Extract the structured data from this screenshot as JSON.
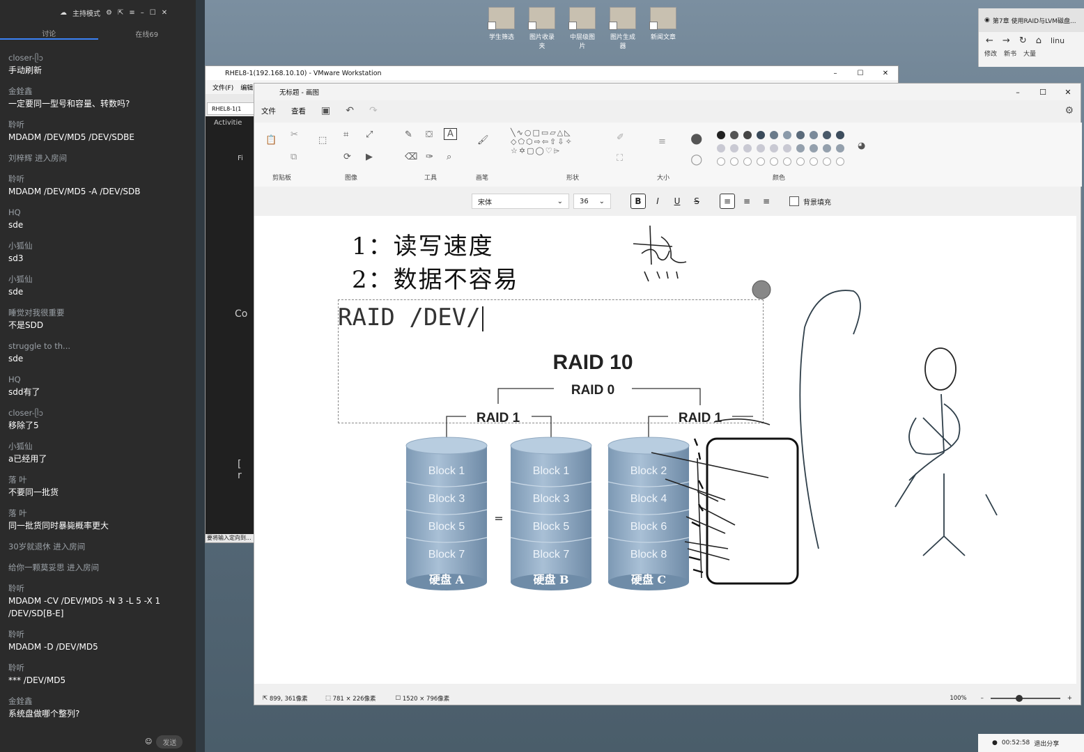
{
  "chat": {
    "mode_label": "主持模式",
    "tabs": [
      "讨论",
      "在线69"
    ],
    "messages": [
      {
        "user": "closer-ᥫᩣ",
        "text": "手动刷新"
      },
      {
        "user": "金銓鑫",
        "text": "一定要同一型号和容量、转数吗?"
      },
      {
        "user": "聆听",
        "text": "MDADM /DEV/MD5 /DEV/SDBE"
      },
      {
        "system": "刘梓辉 进入房间"
      },
      {
        "user": "聆听",
        "text": "MDADM /DEV/MD5 -A /DEV/SDB"
      },
      {
        "user": "HQ",
        "text": "sde"
      },
      {
        "user": "小狐仙",
        "text": "sd3"
      },
      {
        "user": "小狐仙",
        "text": "sde"
      },
      {
        "user": "睡觉对我很重要",
        "text": "不是SDD"
      },
      {
        "user": "struggle to th...",
        "text": "sde"
      },
      {
        "user": "HQ",
        "text": "sdd有了"
      },
      {
        "user": "closer-ᥫᩣ",
        "text": "移除了5"
      },
      {
        "user": "小狐仙",
        "text": "a已经用了"
      },
      {
        "user": "落  叶",
        "text": "不要同一批货"
      },
      {
        "user": "落  叶",
        "text": "同一批货同时暴毙概率更大"
      },
      {
        "system": "30岁就退休 进入房间"
      },
      {
        "system": "给你一颗莫妥思 进入房间"
      },
      {
        "user": "聆听",
        "text": "MDADM -CV /DEV/MD5 -N 3 -L 5 -X 1 /DEV/SD[B-E]"
      },
      {
        "user": "聆听",
        "text": "MDADM -D /DEV/MD5"
      },
      {
        "user": "聆听",
        "text": "*** /DEV/MD5"
      },
      {
        "user": "金銓鑫",
        "text": "系统盘做哪个整列?"
      }
    ],
    "send_label": "发送"
  },
  "desktop_icons": [
    "学生筛选",
    "图片收录夹",
    "中层级图片",
    "图片生成器",
    "新闻文章"
  ],
  "browser": {
    "tab_title": "第7章 使用RAID与LVM磁盘...",
    "address_fragment": "linu",
    "bookmarks": [
      "修改",
      "新书",
      "大量"
    ],
    "recording_time": "00:52:58",
    "recording_exit": "退出分享"
  },
  "vmware": {
    "title": "RHEL8-1(192.168.10.10) - VMware Workstation",
    "menu": [
      "文件(F)",
      "编辑"
    ],
    "tab": "RHEL8-1(1",
    "activities": "Activitie",
    "screen_chars": [
      "Fi",
      "Co",
      "[ r"
    ],
    "status": "要将输入定向到..."
  },
  "paint": {
    "title": "无标题 - 画图",
    "menu": [
      "文件",
      "查看"
    ],
    "group_labels": [
      "剪贴板",
      "图像",
      "工具",
      "画笔",
      "形状",
      "大小",
      "颜色"
    ],
    "font_name": "宋体",
    "font_size": "36",
    "background_fill_label": "背景填充",
    "canvas_text_line1": "1：读写速度",
    "canvas_text_line2": "2：数据不容易",
    "canvas_textbox": "RAID /DEV/",
    "handwriting": "热",
    "raid_title": "RAID 10",
    "raid0_label": "RAID 0",
    "raid1_labels": [
      "RAID 1",
      "RAID 1"
    ],
    "disks": [
      {
        "name": "硬盘 A",
        "blocks": [
          "Block 1",
          "Block 3",
          "Block 5",
          "Block 7"
        ]
      },
      {
        "name": "硬盘 B",
        "blocks": [
          "Block 1",
          "Block 3",
          "Block 5",
          "Block 7"
        ]
      },
      {
        "name": "硬盘 C",
        "blocks": [
          "Block 2",
          "Block 4",
          "Block 6",
          "Block 8"
        ]
      }
    ],
    "equals": "=",
    "status_cursor": "899, 361像素",
    "status_selection": "781 × 226像素",
    "status_canvas": "1520 × 796像素",
    "zoom": "100%",
    "colors": {
      "disk_top": "#b8cde0",
      "disk_body": "#8aa6c0",
      "disk_dark": "#6f8ca8",
      "accent": "#0067c0"
    }
  }
}
